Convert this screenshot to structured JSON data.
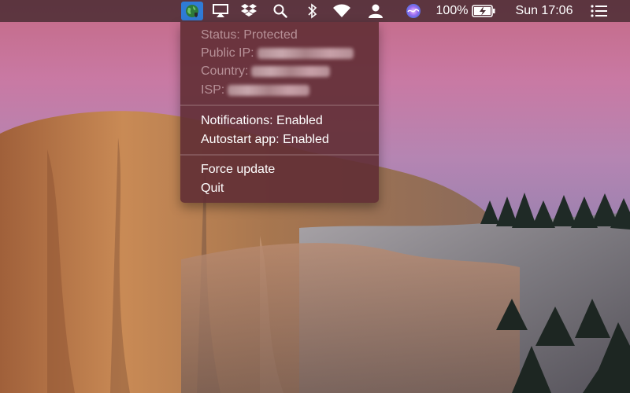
{
  "menubar": {
    "battery_percent": "100%",
    "clock": "Sun 17:06"
  },
  "vpn_menu": {
    "status": "Status: Protected",
    "public_ip_label": "Public IP:",
    "country_label": "Country:",
    "isp_label": "ISP:",
    "notifications": "Notifications: Enabled",
    "autostart": "Autostart app: Enabled",
    "force_update": "Force update",
    "quit": "Quit"
  },
  "icons": {
    "vpn": "globe-shield-icon",
    "airplay": "airplay-icon",
    "dropbox": "dropbox-icon",
    "search": "search-icon",
    "bluetooth": "bluetooth-icon",
    "wifi": "wifi-icon",
    "user": "user-icon",
    "siri": "siri-icon",
    "battery": "battery-charging-icon",
    "notification_center": "list-icon"
  },
  "colors": {
    "menubar_bg": "#462a30",
    "menu_bg": "#602e34",
    "menu_highlight": "#2f7bd6",
    "disabled_text": "#b79198"
  }
}
